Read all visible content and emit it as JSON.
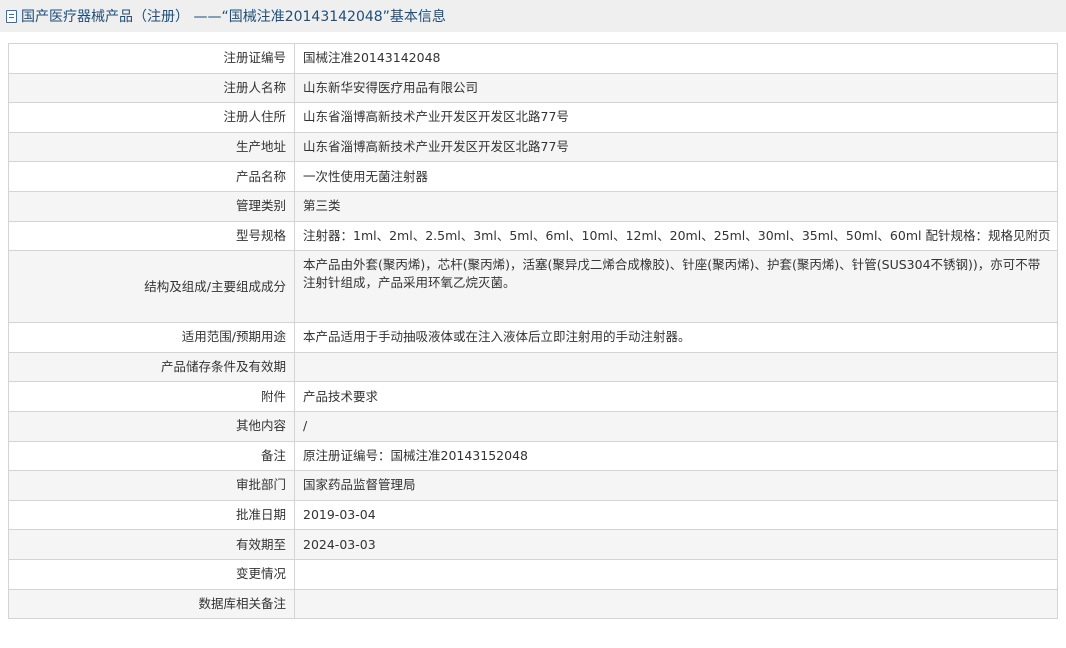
{
  "header": {
    "title": "国产医疗器械产品（注册） ——“国械注准20143142048”基本信息"
  },
  "rows": [
    {
      "label": "注册证编号",
      "value": "国械注准20143142048"
    },
    {
      "label": "注册人名称",
      "value": "山东新华安得医疗用品有限公司"
    },
    {
      "label": "注册人住所",
      "value": "山东省淄博高新技术产业开发区开发区北路77号"
    },
    {
      "label": "生产地址",
      "value": "山东省淄博高新技术产业开发区开发区北路77号"
    },
    {
      "label": "产品名称",
      "value": "一次性使用无菌注射器"
    },
    {
      "label": "管理类别",
      "value": "第三类"
    },
    {
      "label": "型号规格",
      "value": "注射器：1ml、2ml、2.5ml、3ml、5ml、6ml、10ml、12ml、20ml、25ml、30ml、35ml、50ml、60ml 配针规格：规格见附页"
    },
    {
      "label": "结构及组成/主要组成成分",
      "value": "本产品由外套(聚丙烯)，芯杆(聚丙烯)，活塞(聚异戊二烯合成橡胶)、针座(聚丙烯)、护套(聚丙烯)、针管(SUS304不锈钢))，亦可不带注射针组成，产品采用环氧乙烷灭菌。"
    },
    {
      "label": "适用范围/预期用途",
      "value": "本产品适用于手动抽吸液体或在注入液体后立即注射用的手动注射器。"
    },
    {
      "label": "产品储存条件及有效期",
      "value": ""
    },
    {
      "label": "附件",
      "value": "产品技术要求"
    },
    {
      "label": "其他内容",
      "value": "/"
    },
    {
      "label": "备注",
      "value": "原注册证编号：国械注准20143152048"
    },
    {
      "label": "审批部门",
      "value": "国家药品监督管理局"
    },
    {
      "label": "批准日期",
      "value": "2019-03-04"
    },
    {
      "label": "有效期至",
      "value": "2024-03-03"
    },
    {
      "label": "变更情况",
      "value": ""
    },
    {
      "label": "数据库相关备注",
      "value": ""
    }
  ]
}
